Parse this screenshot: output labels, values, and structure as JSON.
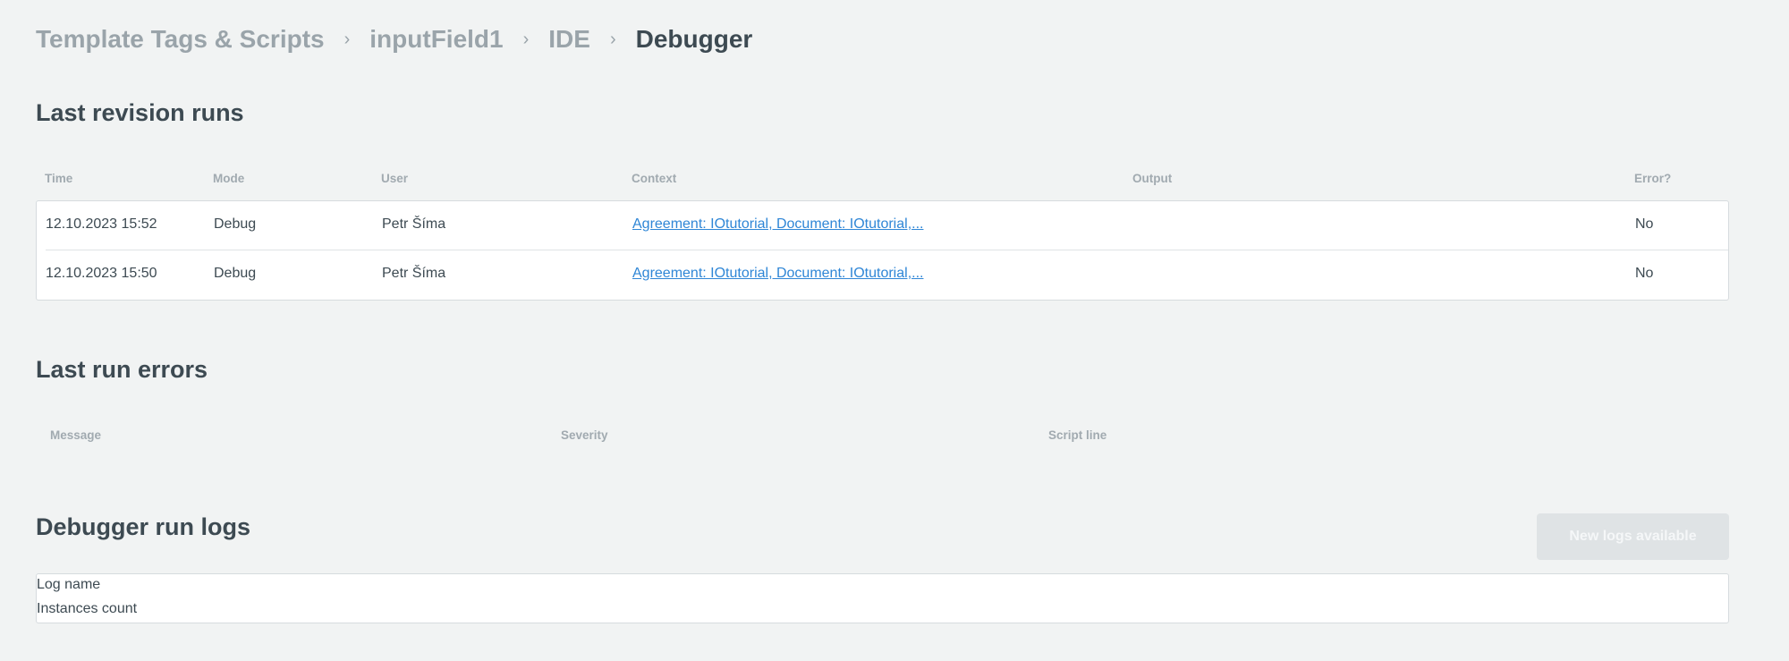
{
  "breadcrumb": {
    "items": [
      "Template Tags & Scripts",
      "inputField1",
      "IDE"
    ],
    "current": "Debugger",
    "separator": "›"
  },
  "revision_runs": {
    "title": "Last revision runs",
    "columns": [
      "Time",
      "Mode",
      "User",
      "Context",
      "Output",
      "Error?"
    ],
    "rows": [
      {
        "time": "12.10.2023 15:52",
        "mode": "Debug",
        "user": "Petr Šíma",
        "context": "Agreement: IOtutorial, Document: IOtutorial,...",
        "output": "",
        "error": "No"
      },
      {
        "time": "12.10.2023 15:50",
        "mode": "Debug",
        "user": "Petr Šíma",
        "context": "Agreement: IOtutorial, Document: IOtutorial,...",
        "output": "",
        "error": "No"
      }
    ]
  },
  "run_errors": {
    "title": "Last run errors",
    "columns": [
      "Message",
      "Severity",
      "Script line"
    ]
  },
  "run_logs": {
    "title": "Debugger run logs",
    "new_logs_button": "New logs available",
    "log_name_label": "Log name",
    "instances_count_label": "Instances count"
  },
  "colors": {
    "background": "#f1f3f3",
    "text": "#3d4a52",
    "muted": "#9aa4aa",
    "link": "#2f86d6",
    "disabled_button": "#dfe3e5"
  }
}
